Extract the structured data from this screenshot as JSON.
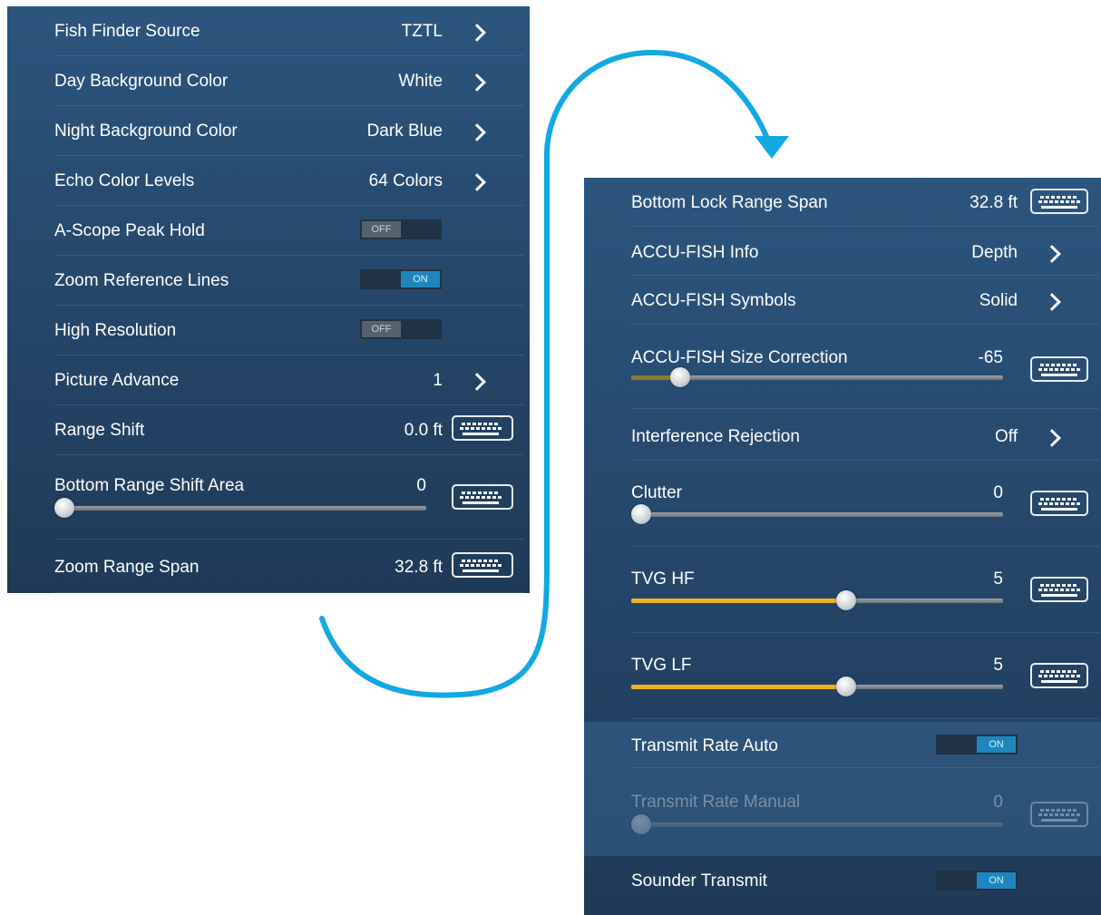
{
  "left_panel": {
    "rows": [
      {
        "label": "Fish Finder Source",
        "value": "TZTL"
      },
      {
        "label": "Day Background Color",
        "value": "White"
      },
      {
        "label": "Night Background Color",
        "value": "Dark Blue"
      },
      {
        "label": "Echo Color Levels",
        "value": "64 Colors"
      },
      {
        "label": "A-Scope Peak Hold",
        "value": "OFF"
      },
      {
        "label": "Zoom Reference Lines",
        "value": "ON"
      },
      {
        "label": "High Resolution",
        "value": "OFF"
      },
      {
        "label": "Picture Advance",
        "value": "1"
      },
      {
        "label": "Range Shift",
        "value": "0.0 ft"
      },
      {
        "label": "Bottom Range Shift Area",
        "value": "0",
        "slider_fraction": 0.0
      },
      {
        "label": "Zoom Range Span",
        "value": "32.8 ft"
      }
    ]
  },
  "right_panel": {
    "rows": [
      {
        "label": "Bottom Lock Range Span",
        "value": "32.8 ft"
      },
      {
        "label": "ACCU-FISH Info",
        "value": "Depth"
      },
      {
        "label": "ACCU-FISH Symbols",
        "value": "Solid"
      },
      {
        "label": "ACCU-FISH Size Correction",
        "value": "-65",
        "slider_fraction": 0.105
      },
      {
        "label": "Interference Rejection",
        "value": "Off"
      },
      {
        "label": "Clutter",
        "value": "0",
        "slider_fraction": 0.0
      },
      {
        "label": "TVG HF",
        "value": "5",
        "slider_fraction": 0.55
      },
      {
        "label": "TVG LF",
        "value": "5",
        "slider_fraction": 0.55
      },
      {
        "label": "Transmit Rate Auto",
        "value": "ON"
      },
      {
        "label": "Transmit Rate Manual",
        "value": "0",
        "slider_fraction": 0.0,
        "disabled": true
      },
      {
        "label": "Sounder Transmit",
        "value": "ON"
      }
    ]
  },
  "colors": {
    "arrow": "#12a8e4",
    "slider_fill_yellow": "#f0b320",
    "slider_fill_olive": "#8a7c2a",
    "toggle_on": "#1f86bd"
  }
}
